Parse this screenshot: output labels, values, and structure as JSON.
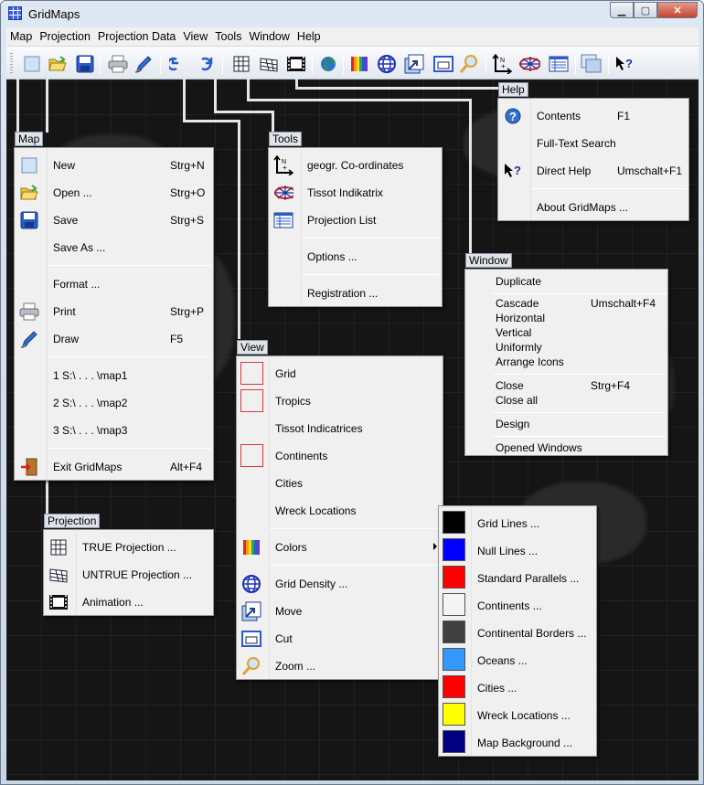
{
  "window": {
    "title": "GridMaps",
    "minimize": "▁",
    "maximize": "▢",
    "close": "✕"
  },
  "menubar": [
    "Map",
    "Projection",
    "Projection Data",
    "View",
    "Tools",
    "Window",
    "Help"
  ],
  "toolbar": {
    "icons": [
      "new-icon",
      "open-icon",
      "save-icon",
      "print-icon",
      "draw-icon",
      "undo-icon",
      "redo-icon",
      "true-projection-icon",
      "untrue-projection-icon",
      "animation-icon",
      "globe-icon",
      "colors-icon",
      "grid-density-icon",
      "move-icon",
      "cut-icon",
      "zoom-icon",
      "coordinates-icon",
      "tissot-icon",
      "projection-list-icon",
      "windows-icon",
      "direct-help-icon"
    ]
  },
  "menus": {
    "map": {
      "tag": "Map",
      "items": [
        {
          "label": "New",
          "shortcut": "Strg+N"
        },
        {
          "label": "Open ...",
          "shortcut": "Strg+O"
        },
        {
          "label": "Save",
          "shortcut": "Strg+S"
        },
        {
          "label": "Save As ...",
          "shortcut": ""
        },
        {
          "label": "Format ...",
          "shortcut": ""
        },
        {
          "label": "Print",
          "shortcut": "Strg+P"
        },
        {
          "label": "Draw",
          "shortcut": "F5"
        },
        {
          "label": "1  S:\\ . . . \\map1",
          "shortcut": ""
        },
        {
          "label": "2  S:\\ . . . \\map2",
          "shortcut": ""
        },
        {
          "label": "3  S:\\ . . . \\map3",
          "shortcut": ""
        },
        {
          "label": "Exit GridMaps",
          "shortcut": "Alt+F4"
        }
      ]
    },
    "projection": {
      "tag": "Projection",
      "items": [
        {
          "label": "TRUE Projection ..."
        },
        {
          "label": "UNTRUE Projection ..."
        },
        {
          "label": "Animation ..."
        }
      ]
    },
    "tools": {
      "tag": "Tools",
      "items": [
        {
          "label": "geogr. Co-ordinates"
        },
        {
          "label": "Tissot Indikatrix"
        },
        {
          "label": "Projection List"
        },
        {
          "label": "Options ..."
        },
        {
          "label": "Registration ..."
        }
      ]
    },
    "view": {
      "tag": "View",
      "items": [
        {
          "label": "Grid"
        },
        {
          "label": "Tropics"
        },
        {
          "label": "Tissot Indicatrices"
        },
        {
          "label": "Continents"
        },
        {
          "label": "Cities"
        },
        {
          "label": "Wreck Locations"
        },
        {
          "label": "Colors"
        },
        {
          "label": "Grid Density ..."
        },
        {
          "label": "Move"
        },
        {
          "label": "Cut"
        },
        {
          "label": "Zoom ..."
        }
      ]
    },
    "help": {
      "tag": "Help",
      "items": [
        {
          "label": "Contents",
          "shortcut": "F1"
        },
        {
          "label": "Full-Text Search",
          "shortcut": ""
        },
        {
          "label": "Direct Help",
          "shortcut": "Umschalt+F1"
        },
        {
          "label": "About GridMaps ...",
          "shortcut": ""
        }
      ]
    },
    "window": {
      "tag": "Window",
      "items": [
        {
          "label": "Duplicate",
          "shortcut": ""
        },
        {
          "label": "Cascade",
          "shortcut": "Umschalt+F4"
        },
        {
          "label": "Horizontal",
          "shortcut": ""
        },
        {
          "label": "Vertical",
          "shortcut": ""
        },
        {
          "label": "Uniformly",
          "shortcut": ""
        },
        {
          "label": "Arrange Icons",
          "shortcut": ""
        },
        {
          "label": "Close",
          "shortcut": "Strg+F4"
        },
        {
          "label": "Close all",
          "shortcut": ""
        },
        {
          "label": "Design",
          "shortcut": ""
        },
        {
          "label": "Opened Windows",
          "shortcut": ""
        }
      ]
    },
    "colors": {
      "items": [
        {
          "label": "Grid Lines ...",
          "color": "#000000"
        },
        {
          "label": "Null Lines ...",
          "color": "#0000ff"
        },
        {
          "label": "Standard Parallels ...",
          "color": "#ff0000"
        },
        {
          "label": "Continents ...",
          "color": "#f4f4f4"
        },
        {
          "label": "Continental Borders ...",
          "color": "#404040"
        },
        {
          "label": "Oceans ...",
          "color": "#3399ff"
        },
        {
          "label": "Cities ...",
          "color": "#ff0000"
        },
        {
          "label": "Wreck Locations ...",
          "color": "#ffff00"
        },
        {
          "label": "Map Background ...",
          "color": "#000080"
        }
      ]
    }
  }
}
